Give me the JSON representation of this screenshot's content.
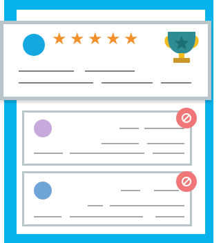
{
  "colors": {
    "frame": "#05b2ec",
    "card_border": "#b8c6cb",
    "card_bg": "#ffffff",
    "line_dark": "#7f7f7f",
    "line_light": "#a9a9a9",
    "star": "#f2902b",
    "avatar_featured": "#14a8e3",
    "avatar_purple": "#c7a9de",
    "avatar_blue": "#6fa4d8",
    "block_badge": "#f07678",
    "trophy_gold": "#f2bd1a",
    "trophy_teal": "#2f8c93",
    "trophy_star": "#1e6e78",
    "trophy_base": "#c9962a"
  },
  "featured_review": {
    "rating": 5,
    "rating_max": 5,
    "avatar_icon": "user-avatar",
    "award_icon": "trophy-star-icon"
  },
  "reviews": [
    {
      "avatar_icon": "user-avatar",
      "status_icon": "blocked-icon"
    },
    {
      "avatar_icon": "user-avatar",
      "status_icon": "blocked-icon"
    }
  ]
}
